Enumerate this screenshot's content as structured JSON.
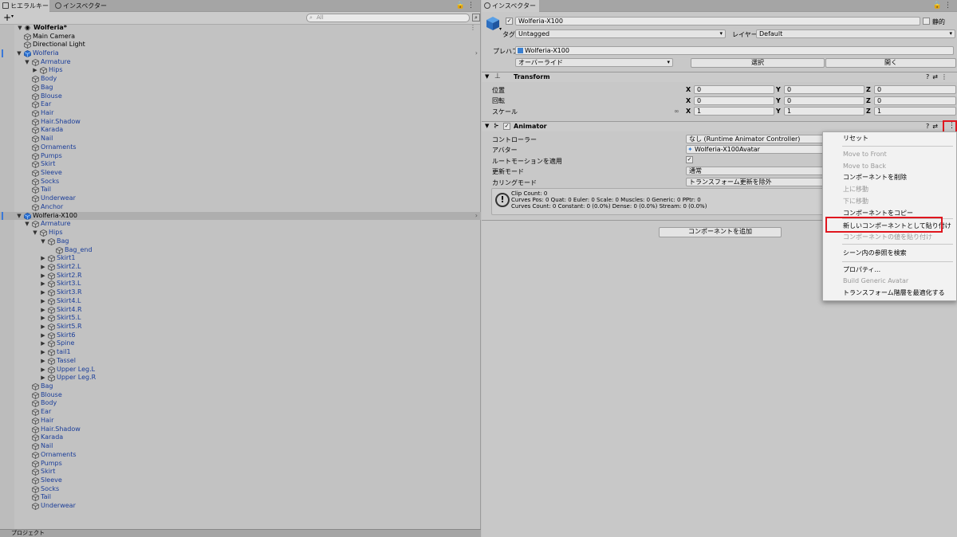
{
  "hierarchy": {
    "tab_label": "ヒエラルキー",
    "inspector_tab_label": "インスペクター",
    "add_label": "+",
    "search_placeholder": "All",
    "scene_name": "Wolferia*",
    "bottom_tab_label": "プロジェクト",
    "rows": [
      {
        "label": "Main Camera",
        "depth": 1,
        "arrow": "",
        "blue": false
      },
      {
        "label": "Directional Light",
        "depth": 1,
        "arrow": "",
        "blue": false
      },
      {
        "label": "Wolferia",
        "depth": 1,
        "arrow": "down",
        "blue": true,
        "prefab": true
      },
      {
        "label": "Armature",
        "depth": 2,
        "arrow": "down",
        "blue": true
      },
      {
        "label": "Hips",
        "depth": 3,
        "arrow": "right",
        "blue": true
      },
      {
        "label": "Body",
        "depth": 2,
        "arrow": "",
        "blue": true
      },
      {
        "label": "Bag",
        "depth": 2,
        "arrow": "",
        "blue": true
      },
      {
        "label": "Blouse",
        "depth": 2,
        "arrow": "",
        "blue": true
      },
      {
        "label": "Ear",
        "depth": 2,
        "arrow": "",
        "blue": true
      },
      {
        "label": "Hair",
        "depth": 2,
        "arrow": "",
        "blue": true
      },
      {
        "label": "Hair.Shadow",
        "depth": 2,
        "arrow": "",
        "blue": true
      },
      {
        "label": "Karada",
        "depth": 2,
        "arrow": "",
        "blue": true
      },
      {
        "label": "Nail",
        "depth": 2,
        "arrow": "",
        "blue": true
      },
      {
        "label": "Ornaments",
        "depth": 2,
        "arrow": "",
        "blue": true
      },
      {
        "label": "Pumps",
        "depth": 2,
        "arrow": "",
        "blue": true
      },
      {
        "label": "Skirt",
        "depth": 2,
        "arrow": "",
        "blue": true
      },
      {
        "label": "Sleeve",
        "depth": 2,
        "arrow": "",
        "blue": true
      },
      {
        "label": "Socks",
        "depth": 2,
        "arrow": "",
        "blue": true
      },
      {
        "label": "Tail",
        "depth": 2,
        "arrow": "",
        "blue": true
      },
      {
        "label": "Underwear",
        "depth": 2,
        "arrow": "",
        "blue": true
      },
      {
        "label": "Anchor",
        "depth": 2,
        "arrow": "",
        "blue": true
      },
      {
        "label": "Wolferia-X100",
        "depth": 1,
        "arrow": "down",
        "blue": false,
        "prefab": true,
        "selected": true
      },
      {
        "label": "Armature",
        "depth": 2,
        "arrow": "down",
        "blue": true
      },
      {
        "label": "Hips",
        "depth": 3,
        "arrow": "down",
        "blue": true
      },
      {
        "label": "Bag",
        "depth": 4,
        "arrow": "down",
        "blue": true
      },
      {
        "label": "Bag_end",
        "depth": 5,
        "arrow": "",
        "blue": true
      },
      {
        "label": "Skirt1",
        "depth": 4,
        "arrow": "right",
        "blue": true
      },
      {
        "label": "Skirt2.L",
        "depth": 4,
        "arrow": "right",
        "blue": true
      },
      {
        "label": "Skirt2.R",
        "depth": 4,
        "arrow": "right",
        "blue": true
      },
      {
        "label": "Skirt3.L",
        "depth": 4,
        "arrow": "right",
        "blue": true
      },
      {
        "label": "Skirt3.R",
        "depth": 4,
        "arrow": "right",
        "blue": true
      },
      {
        "label": "Skirt4.L",
        "depth": 4,
        "arrow": "right",
        "blue": true
      },
      {
        "label": "Skirt4.R",
        "depth": 4,
        "arrow": "right",
        "blue": true
      },
      {
        "label": "Skirt5.L",
        "depth": 4,
        "arrow": "right",
        "blue": true
      },
      {
        "label": "Skirt5.R",
        "depth": 4,
        "arrow": "right",
        "blue": true
      },
      {
        "label": "Skirt6",
        "depth": 4,
        "arrow": "right",
        "blue": true
      },
      {
        "label": "Spine",
        "depth": 4,
        "arrow": "right",
        "blue": true
      },
      {
        "label": "tail1",
        "depth": 4,
        "arrow": "right",
        "blue": true
      },
      {
        "label": "Tassel",
        "depth": 4,
        "arrow": "right",
        "blue": true
      },
      {
        "label": "Upper Leg.L",
        "depth": 4,
        "arrow": "right",
        "blue": true
      },
      {
        "label": "Upper Leg.R",
        "depth": 4,
        "arrow": "right",
        "blue": true
      },
      {
        "label": "Bag",
        "depth": 2,
        "arrow": "",
        "blue": true
      },
      {
        "label": "Blouse",
        "depth": 2,
        "arrow": "",
        "blue": true
      },
      {
        "label": "Body",
        "depth": 2,
        "arrow": "",
        "blue": true
      },
      {
        "label": "Ear",
        "depth": 2,
        "arrow": "",
        "blue": true
      },
      {
        "label": "Hair",
        "depth": 2,
        "arrow": "",
        "blue": true
      },
      {
        "label": "Hair.Shadow",
        "depth": 2,
        "arrow": "",
        "blue": true
      },
      {
        "label": "Karada",
        "depth": 2,
        "arrow": "",
        "blue": true
      },
      {
        "label": "Nail",
        "depth": 2,
        "arrow": "",
        "blue": true
      },
      {
        "label": "Ornaments",
        "depth": 2,
        "arrow": "",
        "blue": true
      },
      {
        "label": "Pumps",
        "depth": 2,
        "arrow": "",
        "blue": true
      },
      {
        "label": "Skirt",
        "depth": 2,
        "arrow": "",
        "blue": true
      },
      {
        "label": "Sleeve",
        "depth": 2,
        "arrow": "",
        "blue": true
      },
      {
        "label": "Socks",
        "depth": 2,
        "arrow": "",
        "blue": true
      },
      {
        "label": "Tail",
        "depth": 2,
        "arrow": "",
        "blue": true
      },
      {
        "label": "Underwear",
        "depth": 2,
        "arrow": "",
        "blue": true
      }
    ]
  },
  "inspector": {
    "tab_label": "インスペクター",
    "object_name": "Wolferia-X100",
    "static_label": "静的",
    "tag_label": "タグ",
    "tag_value": "Untagged",
    "layer_label": "レイヤー",
    "layer_value": "Default",
    "prefab_label": "プレハブ",
    "prefab_value": "Wolferia-X100",
    "override_label": "オーバーライド",
    "select_label": "選択",
    "open_label": "開く",
    "transform": {
      "title": "Transform",
      "position_label": "位置",
      "rotation_label": "回転",
      "scale_label": "スケール",
      "position": {
        "x": "0",
        "y": "0",
        "z": "0"
      },
      "rotation": {
        "x": "0",
        "y": "0",
        "z": "0"
      },
      "scale": {
        "x": "1",
        "y": "1",
        "z": "1"
      }
    },
    "animator": {
      "title": "Animator",
      "controller_label": "コントローラー",
      "controller_value": "なし (Runtime Animator Controller)",
      "avatar_label": "アバター",
      "avatar_value": "Wolferia-X100Avatar",
      "root_motion_label": "ルートモーションを適用",
      "update_mode_label": "更新モード",
      "update_mode_value": "通常",
      "culling_mode_label": "カリングモード",
      "culling_mode_value": "トランスフォーム更新を除外",
      "info_line1": "Clip Count: 0",
      "info_line2": "Curves Pos: 0 Quat: 0 Euler: 0 Scale: 0 Muscles: 0 Generic: 0 PPtr: 0",
      "info_line3": "Curves Count: 0 Constant: 0 (0.0%) Dense: 0 (0.0%) Stream: 0 (0.0%)"
    },
    "add_component_label": "コンポーネントを追加"
  },
  "context_menu": {
    "items": [
      {
        "label": "リセット",
        "disabled": false
      },
      {
        "label": "Move to Front",
        "disabled": true
      },
      {
        "label": "Move to Back",
        "disabled": true
      },
      {
        "label": "コンポーネントを削除",
        "disabled": false
      },
      {
        "label": "上に移動",
        "disabled": true
      },
      {
        "label": "下に移動",
        "disabled": true
      },
      {
        "label": "コンポーネントをコピー",
        "disabled": false
      },
      {
        "label": "新しいコンポーネントとして貼り付け",
        "disabled": false
      },
      {
        "label": "コンポーネントの値を貼り付け",
        "disabled": true
      },
      {
        "label": "シーン内の参照を検索",
        "disabled": false
      },
      {
        "label": "プロパティ...",
        "disabled": false
      },
      {
        "label": "Build Generic Avatar",
        "disabled": true
      },
      {
        "label": "トランスフォーム階層を最適化する",
        "disabled": false
      }
    ]
  },
  "colors": {
    "highlight": "#e0161e",
    "link_blue": "#1a3d99",
    "panel": "#c2c2c2"
  }
}
